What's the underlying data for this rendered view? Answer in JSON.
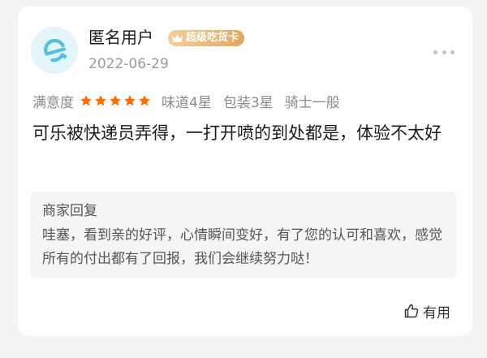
{
  "reviewer": {
    "name": "匿名用户",
    "badge": "超级吃货卡",
    "date": "2022-06-29",
    "avatar_icon": "eleme-logo-icon",
    "badge_icon": "crown-icon"
  },
  "ratings": {
    "satisfaction_label": "满意度",
    "stars": 5,
    "stars_max": 5,
    "taste": "味道4星",
    "packaging": "包装3星",
    "rider": "骑士一般"
  },
  "review": {
    "text": "可乐被快递员弄得，一打开喷的到处都是，体验不太好"
  },
  "merchant_reply": {
    "title": "商家回复",
    "text": "哇塞，看到亲的好评，心情瞬间变好，有了您的认可和喜欢，感觉所有的付出都有了回报，我们会继续努力哒！"
  },
  "actions": {
    "helpful_label": "有用",
    "more_icon": "more-dots-icon",
    "helpful_icon": "thumbs-up-icon"
  },
  "colors": {
    "star": "#ff6d00",
    "badge_gold": "#e0a75e",
    "avatar_bg": "#e3f5f9",
    "avatar_accent": "#4fc2dc"
  }
}
